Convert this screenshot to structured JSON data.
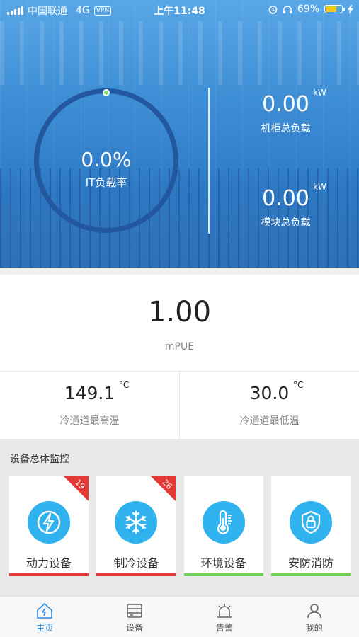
{
  "status_bar": {
    "carrier": "中国联通",
    "network": "4G",
    "vpn": "VPN",
    "time": "上午11:48",
    "battery": "69%",
    "battery_level": 0.69
  },
  "gauge": {
    "value": "0.0%",
    "label": "IT负载率",
    "indicator_color": "#7ee36b"
  },
  "cabinet_load": {
    "value": "0.00",
    "unit": "kW",
    "label": "机柜总负载"
  },
  "module_load": {
    "value": "0.00",
    "unit": "kW",
    "label": "模块总负载"
  },
  "pue": {
    "value": "1.00",
    "label": "mPUE"
  },
  "temps": {
    "max": {
      "value": "149.1",
      "unit": "°C",
      "label": "冷通道最高温"
    },
    "min": {
      "value": "30.0",
      "unit": "°C",
      "label": "冷通道最低温"
    }
  },
  "monitor": {
    "title": "设备总体监控",
    "cards": [
      {
        "label": "动力设备",
        "badge": "19",
        "icon": "lightning-icon",
        "status_color": "#e53935"
      },
      {
        "label": "制冷设备",
        "badge": "26",
        "icon": "snowflake-icon",
        "status_color": "#e53935"
      },
      {
        "label": "环境设备",
        "badge": "",
        "icon": "thermometer-icon",
        "status_color": "#6fd35a"
      },
      {
        "label": "安防消防",
        "badge": "",
        "icon": "shield-lock-icon",
        "status_color": "#6fd35a"
      }
    ]
  },
  "tabbar": {
    "home": "主页",
    "devices": "设备",
    "alarms": "告警",
    "mine": "我的",
    "active_color": "#2f8fe0"
  }
}
